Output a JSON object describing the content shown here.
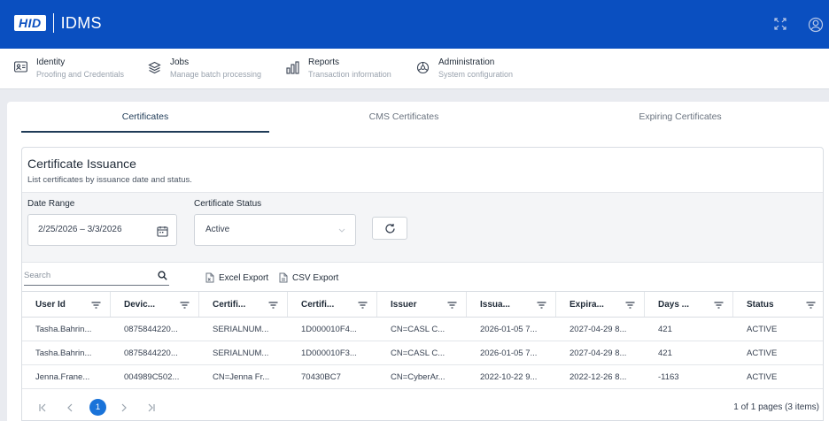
{
  "header": {
    "brand": "HID",
    "product": "IDMS",
    "icons": [
      "fullscreen-icon",
      "user-account-icon"
    ]
  },
  "nav": [
    {
      "title": "Identity",
      "sub": "Proofing and Credentials",
      "icon": "id-card-icon"
    },
    {
      "title": "Jobs",
      "sub": "Manage batch processing",
      "icon": "layers-icon"
    },
    {
      "title": "Reports",
      "sub": "Transaction information",
      "icon": "bar-chart-icon"
    },
    {
      "title": "Administration",
      "sub": "System configuration",
      "icon": "settings-icon"
    }
  ],
  "tabs": [
    {
      "label": "Certificates",
      "active": true
    },
    {
      "label": "CMS Certificates",
      "active": false
    },
    {
      "label": "Expiring Certificates",
      "active": false
    }
  ],
  "card": {
    "title": "Certificate Issuance",
    "subtitle": "List certificates by issuance date and status."
  },
  "filters": {
    "date_label": "Date Range",
    "date_value": "2/25/2026 – 3/3/2026",
    "status_label": "Certificate Status",
    "status_value": "Active"
  },
  "toolbar": {
    "search_placeholder": "Search",
    "excel_label": "Excel Export",
    "csv_label": "CSV Export"
  },
  "table": {
    "columns": [
      "User Id",
      "Devic...",
      "Certifi...",
      "Certifi...",
      "Issuer",
      "Issua...",
      "Expira...",
      "Days ...",
      "Status"
    ],
    "rows": [
      [
        "Tasha.Bahrin...",
        "0875844220...",
        "SERIALNUM...",
        "1D000010F4...",
        "CN=CASL C...",
        "2026-01-05 7...",
        "2027-04-29 8...",
        "421",
        "ACTIVE"
      ],
      [
        "Tasha.Bahrin...",
        "0875844220...",
        "SERIALNUM...",
        "1D000010F3...",
        "CN=CASL C...",
        "2026-01-05 7...",
        "2027-04-29 8...",
        "421",
        "ACTIVE"
      ],
      [
        "Jenna.Frane...",
        "004989C502...",
        "CN=Jenna Fr...",
        "70430BC7",
        "CN=CyberAr...",
        "2022-10-22 9...",
        "2022-12-26 8...",
        "-1163",
        "ACTIVE"
      ]
    ]
  },
  "pager": {
    "current_page": "1",
    "info": "1 of 1 pages (3 items)"
  },
  "colors": {
    "header_bg": "#0a4fc0",
    "active_tab": "#1f3b57",
    "page_badge": "#1a73d9"
  }
}
